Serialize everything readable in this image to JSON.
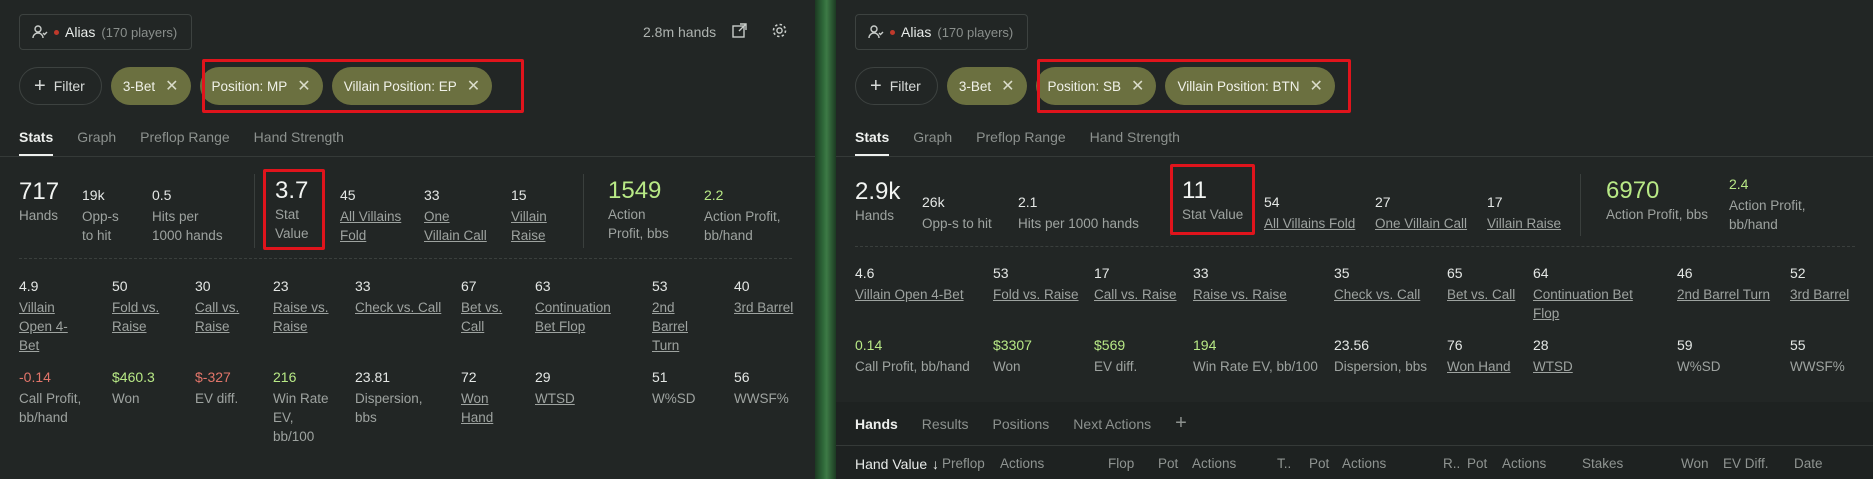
{
  "left": {
    "alias_name": "Alias",
    "alias_count": "(170 players)",
    "hands_count": "2.8m hands",
    "filter_label": "Filter",
    "chips": [
      "3-Bet",
      "Position: MP",
      "Villain Position: EP"
    ],
    "tabs": [
      "Stats",
      "Graph",
      "Preflop Range",
      "Hand Strength"
    ],
    "top": {
      "hands": {
        "v": "717",
        "l": "Hands"
      },
      "opps": {
        "v": "19k",
        "l1": "Opp-s",
        "l2": "to hit"
      },
      "hits": {
        "v": "0.5",
        "l1": "Hits per",
        "l2": "1000 hands"
      },
      "stat": {
        "v": "3.7",
        "l1": "Stat",
        "l2": "Value"
      },
      "avf": {
        "v": "45",
        "l1": "All Villains",
        "l2": "Fold"
      },
      "ovc": {
        "v": "33",
        "l1": "One",
        "l2": "Villain Call"
      },
      "vr": {
        "v": "15",
        "l1": "Villain",
        "l2": "Raise"
      },
      "ap": {
        "v": "1549",
        "l1": "Action",
        "l2": "Profit, bbs"
      },
      "apb": {
        "v": "2.2",
        "l1": "Action Profit,",
        "l2": "bb/hand"
      }
    },
    "row2": [
      {
        "v": "4.9",
        "l": [
          "Villain",
          "Open 4-",
          "Bet"
        ]
      },
      {
        "v": "50",
        "l": [
          "Fold vs.",
          "Raise"
        ]
      },
      {
        "v": "30",
        "l": [
          "Call vs.",
          "Raise"
        ]
      },
      {
        "v": "23",
        "l": [
          "Raise vs.",
          "Raise"
        ]
      },
      {
        "v": "33",
        "l": [
          "Check vs. Call"
        ]
      },
      {
        "v": "67",
        "l": [
          "Bet vs.",
          "Call"
        ]
      },
      {
        "v": "63",
        "l": [
          "Continuation",
          "Bet Flop"
        ]
      },
      {
        "v": "53",
        "l": [
          "2nd",
          "Barrel",
          "Turn"
        ]
      },
      {
        "v": "40",
        "l": [
          "3rd Barrel"
        ]
      }
    ],
    "row3": [
      {
        "v": "-0.14",
        "l": [
          "Call Profit,",
          "bb/hand"
        ]
      },
      {
        "v": "$460.3",
        "l": [
          "Won"
        ]
      },
      {
        "v": "$-327",
        "l": [
          "EV diff."
        ]
      },
      {
        "v": "216",
        "l": [
          "Win Rate",
          "EV,",
          "bb/100"
        ]
      },
      {
        "v": "23.81",
        "l": [
          "Dispersion,",
          "bbs"
        ]
      },
      {
        "v": "72",
        "l": [
          "Won",
          "Hand"
        ]
      },
      {
        "v": "29",
        "l": [
          "WTSD"
        ]
      },
      {
        "v": "51",
        "l": [
          "W%SD"
        ]
      },
      {
        "v": "56",
        "l": [
          "WWSF%"
        ]
      }
    ]
  },
  "right": {
    "alias_name": "Alias",
    "alias_count": "(170 players)",
    "filter_label": "Filter",
    "chips": [
      "3-Bet",
      "Position: SB",
      "Villain Position: BTN"
    ],
    "tabs": [
      "Stats",
      "Graph",
      "Preflop Range",
      "Hand Strength"
    ],
    "top": {
      "hands": {
        "v": "2.9k",
        "l": "Hands"
      },
      "opps": {
        "v": "26k",
        "l": "Opp-s to hit"
      },
      "hits": {
        "v": "2.1",
        "l": "Hits per 1000 hands"
      },
      "stat": {
        "v": "11",
        "l": "Stat Value"
      },
      "avf": {
        "v": "54",
        "l": "All Villains Fold"
      },
      "ovc": {
        "v": "27",
        "l": "One Villain Call"
      },
      "vr": {
        "v": "17",
        "l": "Villain Raise"
      },
      "ap": {
        "v": "6970",
        "l": "Action Profit, bbs"
      },
      "apb": {
        "v": "2.4",
        "l1": "Action Profit,",
        "l2": "bb/hand"
      }
    },
    "row2": [
      {
        "v": "4.6",
        "l": [
          "Villain Open 4-Bet"
        ]
      },
      {
        "v": "53",
        "l": [
          "Fold vs. Raise"
        ]
      },
      {
        "v": "17",
        "l": [
          "Call vs. Raise"
        ]
      },
      {
        "v": "33",
        "l": [
          "Raise vs. Raise"
        ]
      },
      {
        "v": "35",
        "l": [
          "Check vs. Call"
        ]
      },
      {
        "v": "65",
        "l": [
          "Bet vs. Call"
        ]
      },
      {
        "v": "64",
        "l": [
          "Continuation Bet",
          "Flop"
        ]
      },
      {
        "v": "46",
        "l": [
          "2nd Barrel Turn"
        ]
      },
      {
        "v": "52",
        "l": [
          "3rd Barrel"
        ]
      }
    ],
    "row3": [
      {
        "v": "0.14",
        "l": [
          "Call Profit, bb/hand"
        ]
      },
      {
        "v": "$3307",
        "l": [
          "Won"
        ]
      },
      {
        "v": "$569",
        "l": [
          "EV diff."
        ]
      },
      {
        "v": "194",
        "l": [
          "Win Rate EV, bb/100"
        ]
      },
      {
        "v": "23.56",
        "l": [
          "Dispersion, bbs"
        ]
      },
      {
        "v": "76",
        "l": [
          "Won Hand"
        ]
      },
      {
        "v": "28",
        "l": [
          "WTSD"
        ]
      },
      {
        "v": "59",
        "l": [
          "W%SD"
        ]
      },
      {
        "v": "55",
        "l": [
          "WWSF%"
        ]
      }
    ],
    "bottom_tabs": [
      "Hands",
      "Results",
      "Positions",
      "Next Actions",
      "+"
    ],
    "columns": [
      "Hand Value",
      "Preflop",
      "Actions",
      "Flop",
      "Pot",
      "Actions",
      "T..",
      "Pot",
      "Actions",
      "R..",
      "Pot",
      "Actions",
      "Stakes",
      "Won",
      "EV Diff.",
      "Date"
    ]
  }
}
